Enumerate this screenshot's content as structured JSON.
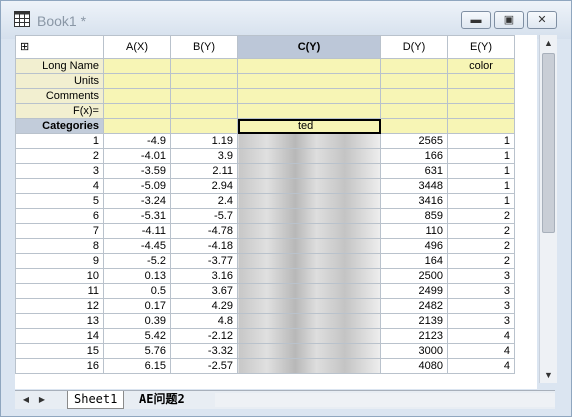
{
  "window": {
    "title": "Book1 *"
  },
  "columns": [
    "A(X)",
    "B(Y)",
    "C(Y)",
    "D(Y)",
    "E(Y)"
  ],
  "meta_rows": [
    {
      "label": "Long Name",
      "values": [
        "",
        "",
        "",
        "",
        "color"
      ]
    },
    {
      "label": "Units",
      "values": [
        "",
        "",
        "",
        "",
        ""
      ]
    },
    {
      "label": "Comments",
      "values": [
        "",
        "",
        "",
        "",
        ""
      ]
    },
    {
      "label": "F(x)=",
      "values": [
        "",
        "",
        "",
        "",
        ""
      ]
    }
  ],
  "categories_row": {
    "label": "Categories",
    "values": [
      "",
      "",
      "ted",
      "",
      ""
    ]
  },
  "rows": [
    {
      "n": "1",
      "a": "-4.9",
      "b": "1.19",
      "d": "2565",
      "e": "1"
    },
    {
      "n": "2",
      "a": "-4.01",
      "b": "3.9",
      "d": "166",
      "e": "1"
    },
    {
      "n": "3",
      "a": "-3.59",
      "b": "2.11",
      "d": "631",
      "e": "1"
    },
    {
      "n": "4",
      "a": "-5.09",
      "b": "2.94",
      "d": "3448",
      "e": "1"
    },
    {
      "n": "5",
      "a": "-3.24",
      "b": "2.4",
      "d": "3416",
      "e": "1"
    },
    {
      "n": "6",
      "a": "-5.31",
      "b": "-5.7",
      "d": "859",
      "e": "2"
    },
    {
      "n": "7",
      "a": "-4.11",
      "b": "-4.78",
      "d": "110",
      "e": "2"
    },
    {
      "n": "8",
      "a": "-4.45",
      "b": "-4.18",
      "d": "496",
      "e": "2"
    },
    {
      "n": "9",
      "a": "-5.2",
      "b": "-3.77",
      "d": "164",
      "e": "2"
    },
    {
      "n": "10",
      "a": "0.13",
      "b": "3.16",
      "d": "2500",
      "e": "3"
    },
    {
      "n": "11",
      "a": "0.5",
      "b": "3.67",
      "d": "2499",
      "e": "3"
    },
    {
      "n": "12",
      "a": "0.17",
      "b": "4.29",
      "d": "2482",
      "e": "3"
    },
    {
      "n": "13",
      "a": "0.39",
      "b": "4.8",
      "d": "2139",
      "e": "3"
    },
    {
      "n": "14",
      "a": "5.42",
      "b": "-2.12",
      "d": "2123",
      "e": "4"
    },
    {
      "n": "15",
      "a": "5.76",
      "b": "-3.32",
      "d": "3000",
      "e": "4"
    },
    {
      "n": "16",
      "a": "6.15",
      "b": "-2.57",
      "d": "4080",
      "e": "4"
    }
  ],
  "sheets": [
    "Sheet1",
    "AE问题2"
  ],
  "colors": {
    "selected_header": "#bcc7d8",
    "meta_bg": "#f7f5b5"
  }
}
